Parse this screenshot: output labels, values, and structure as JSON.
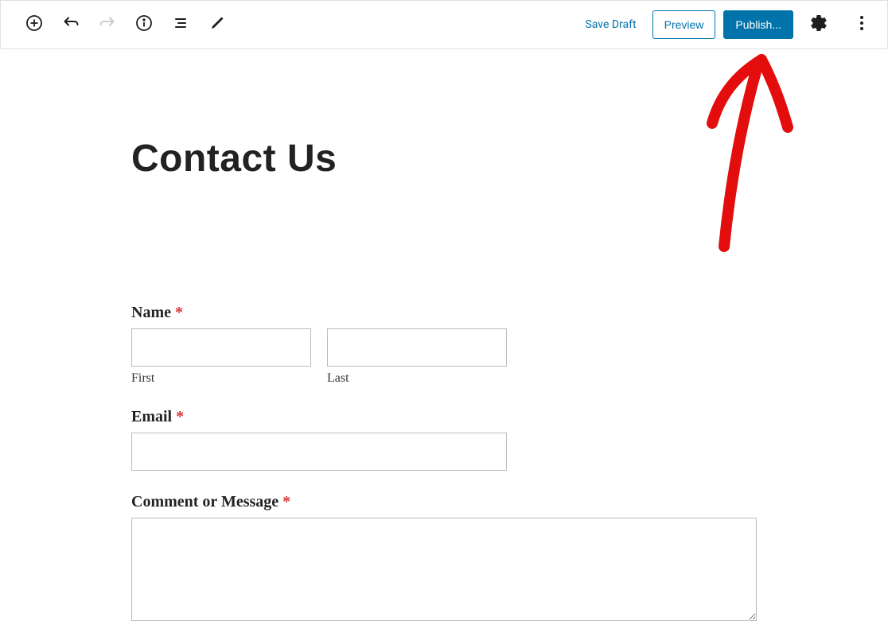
{
  "toolbar": {
    "save_draft": "Save Draft",
    "preview": "Preview",
    "publish": "Publish..."
  },
  "page": {
    "title": "Contact Us"
  },
  "form": {
    "name": {
      "label": "Name",
      "first_sub": "First",
      "last_sub": "Last"
    },
    "email": {
      "label": "Email"
    },
    "message": {
      "label": "Comment or Message"
    },
    "required_mark": "*"
  }
}
